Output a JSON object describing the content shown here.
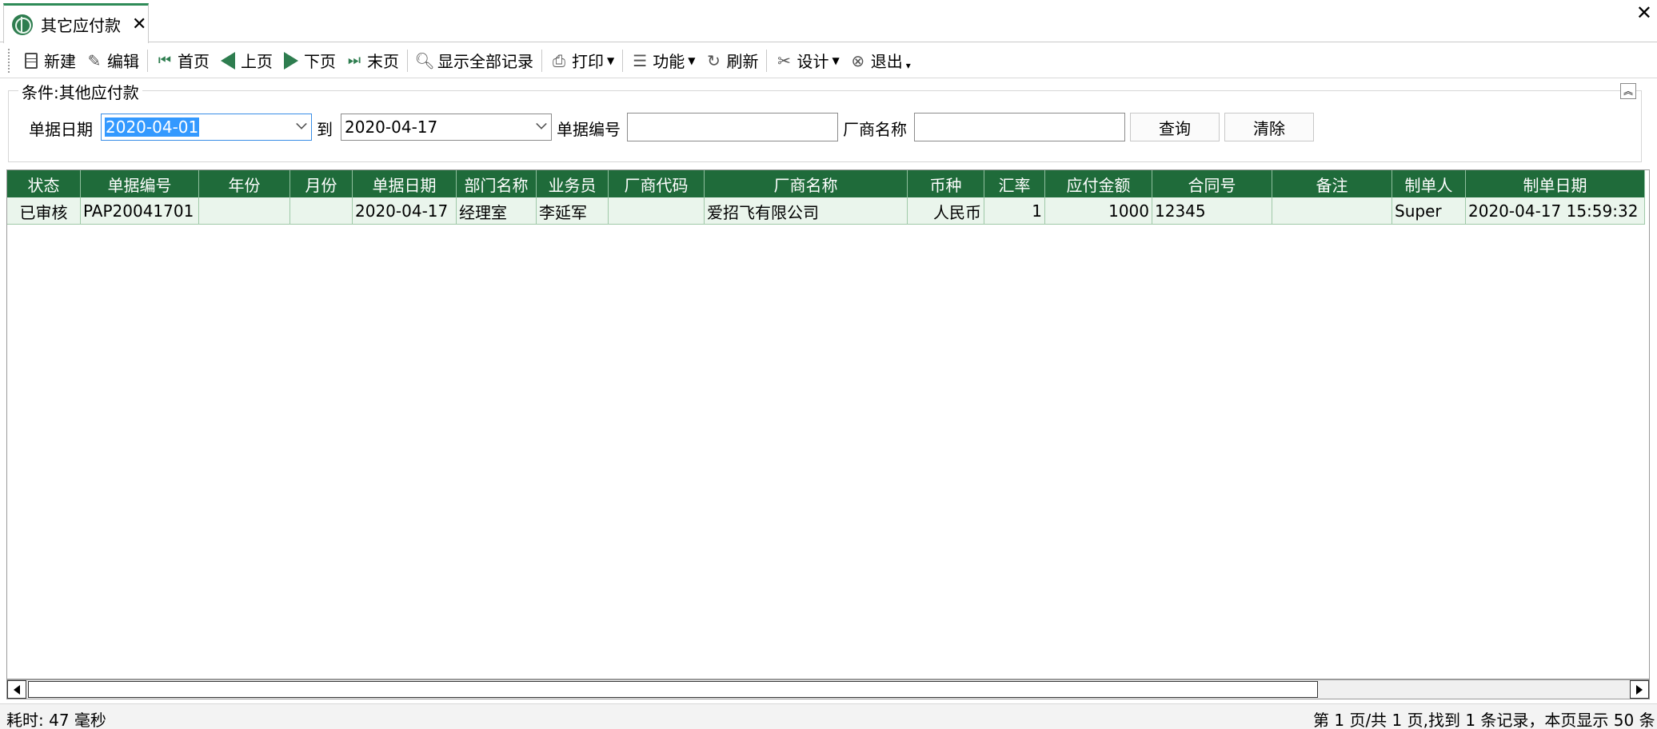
{
  "tab": {
    "title": "其它应付款",
    "close": "✕"
  },
  "window": {
    "close": "✕"
  },
  "toolbar": {
    "new": "新建",
    "edit": "编辑",
    "first": "首页",
    "prev": "上页",
    "next": "下页",
    "last": "末页",
    "show_all": "显示全部记录",
    "print": "打印",
    "function": "功能",
    "refresh": "刷新",
    "design": "设计",
    "exit": "退出"
  },
  "criteria": {
    "legend": "条件:其他应付款",
    "date_label": "单据日期",
    "date_from": "2020-04-01",
    "to_label": "到",
    "date_to": "2020-04-17",
    "doc_no_label": "单据编号",
    "doc_no_value": "",
    "vendor_label": "厂商名称",
    "vendor_value": "",
    "query_button": "查询",
    "clear_button": "清除"
  },
  "grid": {
    "columns": [
      "状态",
      "单据编号",
      "年份",
      "月份",
      "单据日期",
      "部门名称",
      "业务员",
      "厂商代码",
      "厂商名称",
      "币种",
      "汇率",
      "应付金额",
      "合同号",
      "备注",
      "制单人",
      "制单日期"
    ],
    "rows": [
      [
        "已审核",
        "PAP20041701",
        "",
        "",
        "2020-04-17",
        "经理室",
        "李延军",
        "",
        "爱招飞有限公司",
        "人民币",
        "1",
        "1000",
        "12345",
        "",
        "Super",
        "2020-04-17 15:59:32"
      ]
    ]
  },
  "status": {
    "elapsed": "耗时: 47 毫秒",
    "paging": "第 1 页/共 1 页,找到 1 条记录，本页显示 50 条"
  },
  "colors": {
    "header_green": "#1f6b3a",
    "row_bg": "#eaf5ec",
    "accent": "#2e8b57"
  }
}
